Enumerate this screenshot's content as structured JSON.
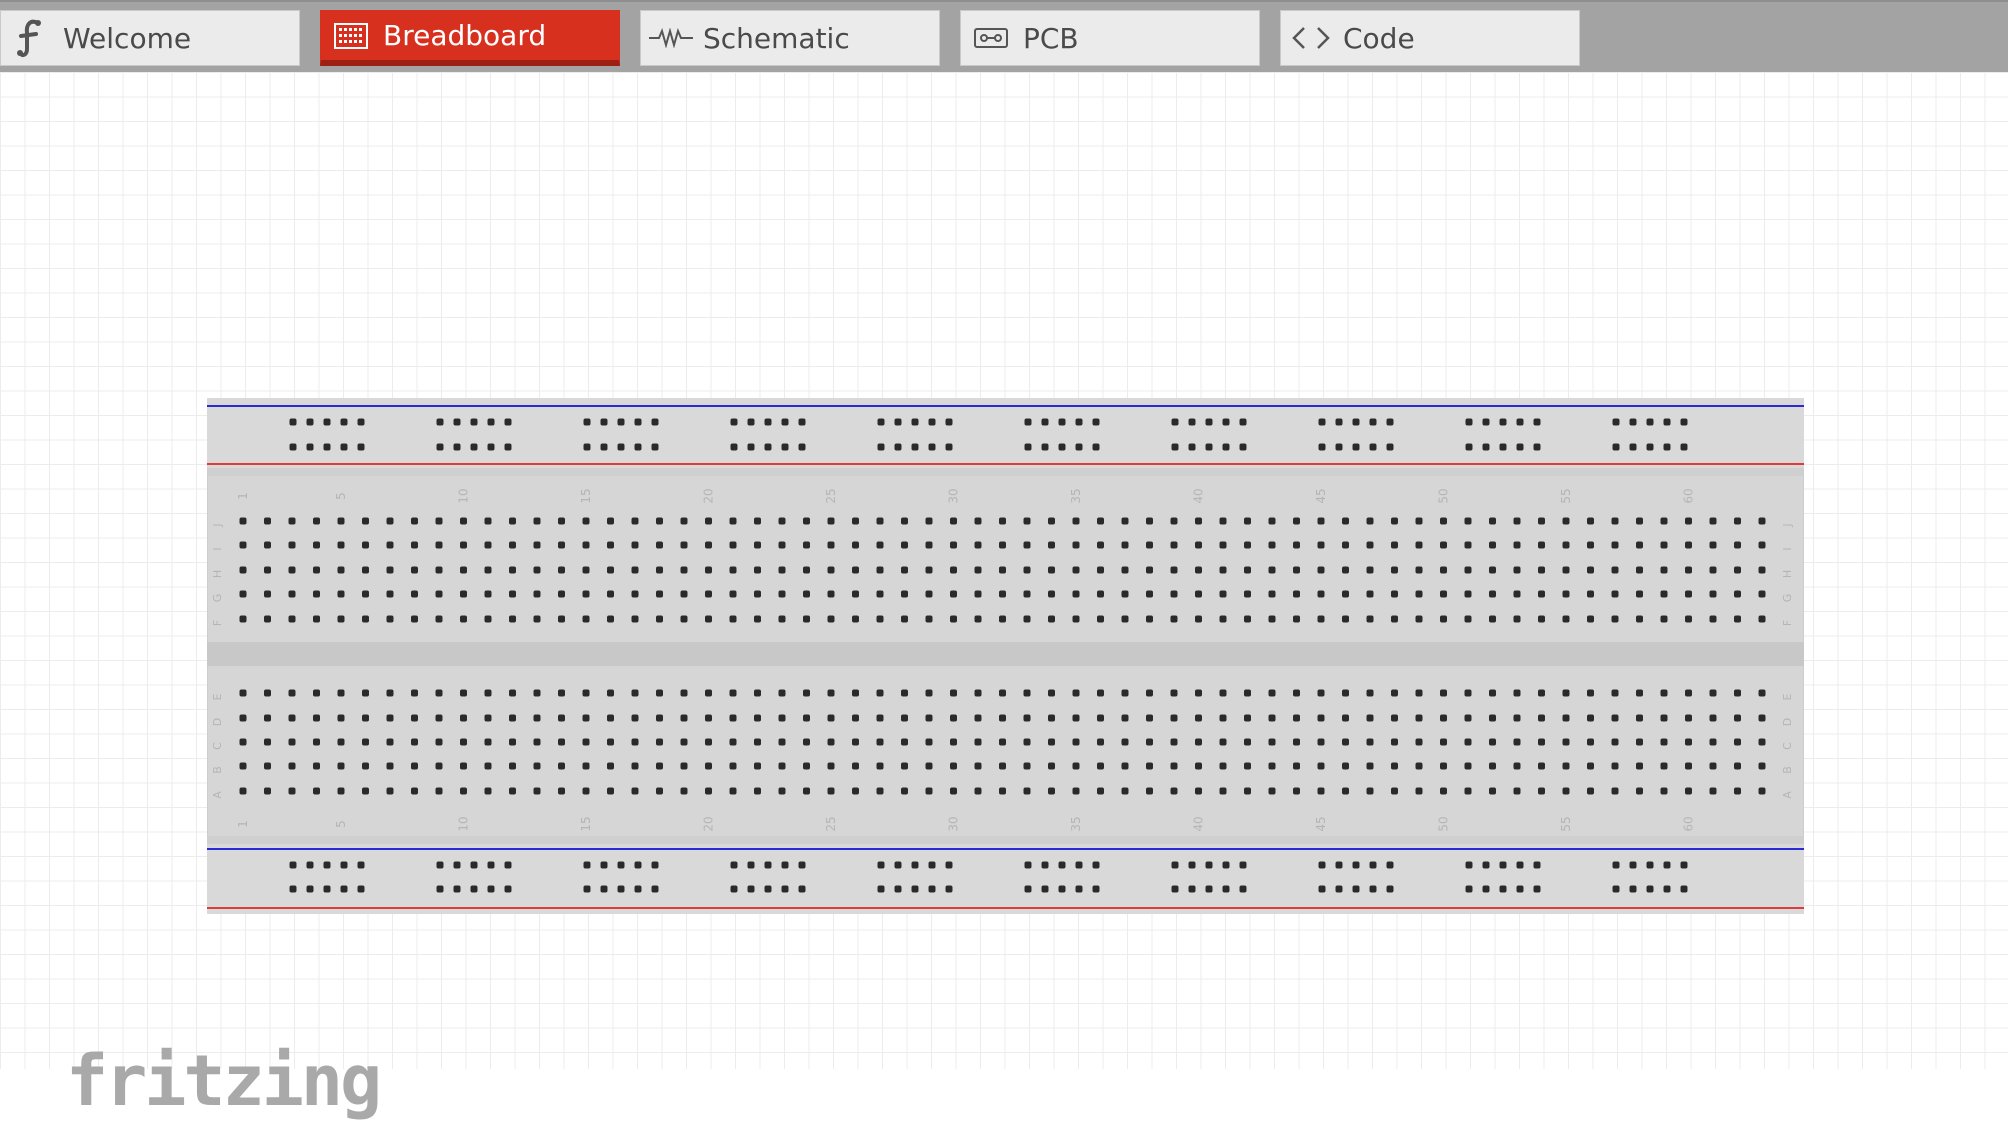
{
  "tabs": [
    {
      "label": "Welcome",
      "icon": "fritzing-f-icon",
      "active": false
    },
    {
      "label": "Breadboard",
      "icon": "breadboard-icon",
      "active": true
    },
    {
      "label": "Schematic",
      "icon": "resistor-icon",
      "active": false
    },
    {
      "label": "PCB",
      "icon": "pcb-icon",
      "active": false
    },
    {
      "label": "Code",
      "icon": "code-brackets-icon",
      "active": false
    }
  ],
  "colors": {
    "accent": "#d7301f",
    "rail_blue": "#2b2bd6",
    "rail_red": "#e03b3b",
    "board": "#d6d6d6"
  },
  "breadboard": {
    "columns": 63,
    "row_letters_top": [
      "J",
      "I",
      "H",
      "G",
      "F"
    ],
    "row_letters_bottom": [
      "E",
      "D",
      "C",
      "B",
      "A"
    ],
    "column_numbers": [
      "1",
      "5",
      "10",
      "15",
      "20",
      "25",
      "30",
      "35",
      "40",
      "45",
      "50",
      "55",
      "60"
    ],
    "rail_groups": 10,
    "holes_per_group": 5
  },
  "logo": {
    "text": "fritzing"
  }
}
